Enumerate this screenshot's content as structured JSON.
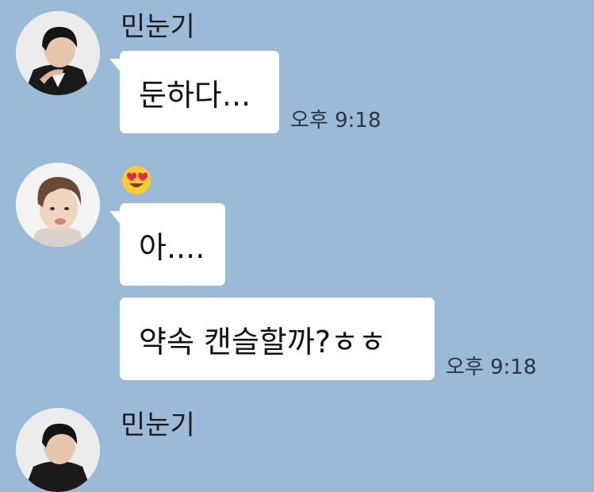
{
  "chat": {
    "messages": [
      {
        "sender": "민눈기",
        "avatar": "avatar-dark-hair-man",
        "text": "둔하다...",
        "time": "오후 9:18"
      },
      {
        "sender_icon": "heart-eyes-emoji",
        "avatar": "avatar-curly-hair-man",
        "texts": [
          "아....",
          "약속 캔슬할까?ㅎㅎ"
        ],
        "time": "오후 9:18"
      },
      {
        "sender": "민눈기",
        "avatar": "avatar-dark-hair-man"
      }
    ]
  },
  "colors": {
    "background": "#9bbad8",
    "bubble": "#ffffff",
    "emoji_face": "#ffcc33",
    "emoji_hearts": "#e8274b"
  }
}
